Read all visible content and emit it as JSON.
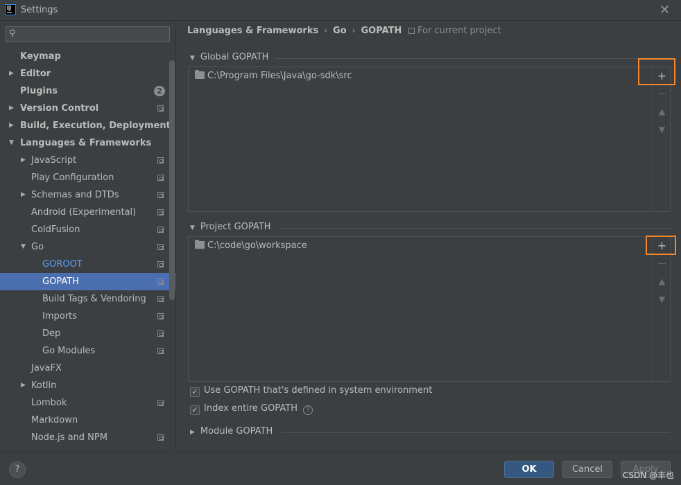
{
  "window": {
    "title": "Settings",
    "close_icon": "close-icon"
  },
  "search": {
    "placeholder": "",
    "value": ""
  },
  "sidebar": {
    "items": [
      {
        "label": "Keymap"
      },
      {
        "label": "Editor"
      },
      {
        "label": "Plugins",
        "badge": "2"
      },
      {
        "label": "Version Control"
      },
      {
        "label": "Build, Execution, Deployment"
      },
      {
        "label": "Languages & Frameworks"
      },
      {
        "label": "JavaScript"
      },
      {
        "label": "Play Configuration"
      },
      {
        "label": "Schemas and DTDs"
      },
      {
        "label": "Android (Experimental)"
      },
      {
        "label": "ColdFusion"
      },
      {
        "label": "Go"
      },
      {
        "label": "GOROOT"
      },
      {
        "label": "GOPATH"
      },
      {
        "label": "Build Tags & Vendoring"
      },
      {
        "label": "Imports"
      },
      {
        "label": "Dep"
      },
      {
        "label": "Go Modules"
      },
      {
        "label": "JavaFX"
      },
      {
        "label": "Kotlin"
      },
      {
        "label": "Lombok"
      },
      {
        "label": "Markdown"
      },
      {
        "label": "Node.js and NPM"
      }
    ]
  },
  "breadcrumb": {
    "part1": "Languages & Frameworks",
    "part2": "Go",
    "part3": "GOPATH",
    "separator": "›"
  },
  "scope_note": "For current project",
  "global_gopath": {
    "header": "Global GOPATH",
    "entries": [
      "C:\\Program Files\\Java\\go-sdk\\src"
    ]
  },
  "project_gopath": {
    "header": "Project GOPATH",
    "entries": [
      "C:\\code\\go\\workspace"
    ]
  },
  "options": {
    "use_system_gopath": {
      "label": "Use GOPATH that's defined in system environment",
      "checked": true
    },
    "index_entire_gopath": {
      "label": "Index entire GOPATH",
      "checked": true
    }
  },
  "module_gopath": {
    "header": "Module GOPATH"
  },
  "footer": {
    "help_label": "?",
    "ok_label": "OK",
    "cancel_label": "Cancel",
    "apply_label": "Apply",
    "watermark": "CSDN @丰也"
  },
  "colors": {
    "selection": "#4b6eaf",
    "highlight_box": "#f5862a",
    "link": "#589df6",
    "primary_button": "#365880"
  }
}
